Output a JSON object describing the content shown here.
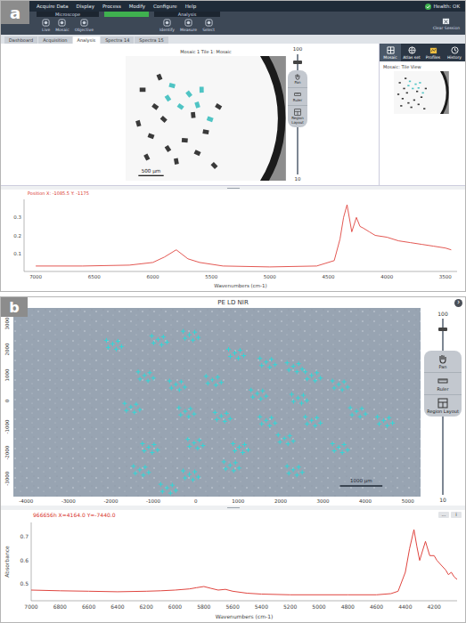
{
  "figure_a": {
    "label": "a",
    "menu": [
      "Acquire Data",
      "Display",
      "Process",
      "Modify",
      "Configure",
      "Help"
    ],
    "status": "Health: OK",
    "toolbar": {
      "groups": [
        {
          "title": "Microscope",
          "buttons": [
            "Live",
            "Mosaic",
            "Objective"
          ]
        },
        {
          "title": "Analysis",
          "buttons": [
            "Identify",
            "Measure",
            "Select"
          ]
        }
      ],
      "progress": {
        "level": 1.0
      },
      "actions": [
        "Clear Session"
      ]
    },
    "tabs": [
      {
        "label": "Dashboard",
        "selected": false
      },
      {
        "label": "Acquisition",
        "selected": false
      },
      {
        "label": "Analysis",
        "selected": true
      },
      {
        "label": "Spectra 14",
        "selected": false
      },
      {
        "label": "Spectra 15",
        "selected": false
      }
    ],
    "mosaic": {
      "title": "Mosaic 1 Tile 1: Mosaic",
      "scale": "500 µm",
      "particles": [
        {
          "x": 200,
          "y": 400,
          "kind": "dark"
        },
        {
          "x": 350,
          "y": 600,
          "kind": "dark"
        },
        {
          "x": 150,
          "y": 800,
          "kind": "dark"
        },
        {
          "x": 300,
          "y": 950,
          "kind": "dark"
        },
        {
          "x": 500,
          "y": 1100,
          "kind": "dark"
        },
        {
          "x": 700,
          "y": 1000,
          "kind": "dark"
        },
        {
          "x": 450,
          "y": 750,
          "kind": "dark"
        },
        {
          "x": 600,
          "y": 1250,
          "kind": "dark"
        },
        {
          "x": 850,
          "y": 1150,
          "kind": "dark"
        },
        {
          "x": 250,
          "y": 1200,
          "kind": "dark"
        },
        {
          "x": 950,
          "y": 900,
          "kind": "dark"
        },
        {
          "x": 1050,
          "y": 1300,
          "kind": "dark"
        },
        {
          "x": 800,
          "y": 700,
          "kind": "dark"
        },
        {
          "x": 1100,
          "y": 600,
          "kind": "dark"
        },
        {
          "x": 400,
          "y": 250,
          "kind": "dark"
        },
        {
          "x": 550,
          "y": 350,
          "kind": "analyzed"
        },
        {
          "x": 750,
          "y": 450,
          "kind": "analyzed"
        },
        {
          "x": 900,
          "y": 400,
          "kind": "analyzed"
        },
        {
          "x": 650,
          "y": 600,
          "kind": "analyzed"
        },
        {
          "x": 850,
          "y": 580,
          "kind": "analyzed"
        },
        {
          "x": 1000,
          "y": 750,
          "kind": "analyzed"
        },
        {
          "x": 500,
          "y": 500,
          "kind": "analyzed"
        }
      ]
    },
    "zoom": {
      "max": "100",
      "min": "10",
      "level": 0.95
    },
    "tools": [
      {
        "label": "Pan"
      },
      {
        "label": "Ruler"
      },
      {
        "label": "Region Layout"
      }
    ],
    "sidebar": {
      "tabs": [
        {
          "label": "Mosaic",
          "selected": true
        },
        {
          "label": "Atlas set",
          "selected": false
        },
        {
          "label": "Profiles",
          "selected": false
        },
        {
          "label": "History",
          "selected": false
        }
      ],
      "view_label": "Mosaic: Tile View"
    },
    "spectrum": {
      "readout": "Position X: -1085.5 Y: -1175",
      "x_label": "Wavenumbers (cm-1)",
      "x_ticks": [
        "7000",
        "6500",
        "6000",
        "5500",
        "5000",
        "4500",
        "4000",
        "3500"
      ],
      "y_ticks": [
        "0.1",
        "0.2",
        "0.3"
      ],
      "series": {
        "x": [
          7000,
          6600,
          6200,
          6000,
          5900,
          5800,
          5700,
          5600,
          5400,
          5000,
          4600,
          4450,
          4400,
          4370,
          4340,
          4300,
          4260,
          4230,
          4200,
          4150,
          4100,
          4000,
          3900,
          3800,
          3700,
          3600,
          3500,
          3450
        ],
        "y": [
          0.03,
          0.03,
          0.035,
          0.05,
          0.08,
          0.12,
          0.07,
          0.05,
          0.03,
          0.025,
          0.03,
          0.06,
          0.18,
          0.3,
          0.37,
          0.22,
          0.3,
          0.25,
          0.24,
          0.22,
          0.2,
          0.19,
          0.17,
          0.16,
          0.15,
          0.14,
          0.13,
          0.12
        ]
      }
    }
  },
  "figure_b": {
    "label": "b",
    "title": "PE LD NIR",
    "nav_button": "›",
    "image": {
      "x_ticks": [
        "-4000",
        "-3000",
        "-2000",
        "-1000",
        "0",
        "1000",
        "2000",
        "3000",
        "4000",
        "5000"
      ],
      "y_ticks": [
        "3000",
        "2000",
        "1000",
        "0",
        "-1000",
        "-2000",
        "-3000"
      ],
      "scale": "1000 µm",
      "markers": [
        {
          "x": -1960,
          "y": 2210
        },
        {
          "x": -890,
          "y": 2380
        },
        {
          "x": -150,
          "y": 2560
        },
        {
          "x": 920,
          "y": 1860
        },
        {
          "x": 1660,
          "y": 1510
        },
        {
          "x": 2300,
          "y": 1340
        },
        {
          "x": 2730,
          "y": 990
        },
        {
          "x": -1210,
          "y": 990
        },
        {
          "x": -470,
          "y": 640
        },
        {
          "x": 390,
          "y": 820
        },
        {
          "x": 1450,
          "y": 290
        },
        {
          "x": 2410,
          "y": 120
        },
        {
          "x": 3370,
          "y": 640
        },
        {
          "x": -1530,
          "y": -230
        },
        {
          "x": -250,
          "y": -400
        },
        {
          "x": 600,
          "y": -580
        },
        {
          "x": 1660,
          "y": -750
        },
        {
          "x": 2730,
          "y": -750
        },
        {
          "x": 3790,
          "y": -400
        },
        {
          "x": 4430,
          "y": -750
        },
        {
          "x": -1110,
          "y": -1790
        },
        {
          "x": -40,
          "y": -1620
        },
        {
          "x": 1025,
          "y": -1790
        },
        {
          "x": 2090,
          "y": -1450
        },
        {
          "x": 3370,
          "y": -1790
        },
        {
          "x": -1320,
          "y": -2660
        },
        {
          "x": -150,
          "y": -2840
        },
        {
          "x": 810,
          "y": -2490
        },
        {
          "x": 2300,
          "y": -2660
        },
        {
          "x": -680,
          "y": -3360
        }
      ]
    },
    "zoom": {
      "max": "100",
      "min": "10",
      "level": 0.95
    },
    "tools": [
      {
        "label": "Pan"
      },
      {
        "label": "Ruler"
      },
      {
        "label": "Region Layout"
      }
    ],
    "spectrum": {
      "readout": "966656h X=4164.0 Y=-7440.0",
      "buttons": [
        "...",
        "i"
      ],
      "x_label": "Wavenumbers (cm-1)",
      "y_label": "Absorbance",
      "x_ticks": [
        "7000",
        "6800",
        "6600",
        "6400",
        "6200",
        "6000",
        "5800",
        "5600",
        "5400",
        "5200",
        "5000",
        "4800",
        "4600",
        "4400",
        "4200"
      ],
      "y_ticks": [
        "0.5",
        "0.6",
        "0.7"
      ],
      "series": {
        "x": [
          7000,
          6800,
          6600,
          6400,
          6200,
          6100,
          6000,
          5900,
          5850,
          5800,
          5750,
          5700,
          5650,
          5600,
          5500,
          5400,
          5200,
          5000,
          4800,
          4600,
          4500,
          4450,
          4400,
          4370,
          4340,
          4320,
          4300,
          4280,
          4260,
          4250,
          4230,
          4200,
          4180,
          4150,
          4120,
          4100,
          4080,
          4060,
          4040
        ],
        "y": [
          0.475,
          0.472,
          0.47,
          0.468,
          0.47,
          0.472,
          0.475,
          0.48,
          0.485,
          0.49,
          0.482,
          0.475,
          0.478,
          0.47,
          0.462,
          0.458,
          0.455,
          0.455,
          0.455,
          0.455,
          0.46,
          0.47,
          0.55,
          0.65,
          0.73,
          0.66,
          0.6,
          0.64,
          0.68,
          0.66,
          0.62,
          0.62,
          0.6,
          0.58,
          0.56,
          0.54,
          0.55,
          0.53,
          0.52
        ]
      }
    }
  }
}
